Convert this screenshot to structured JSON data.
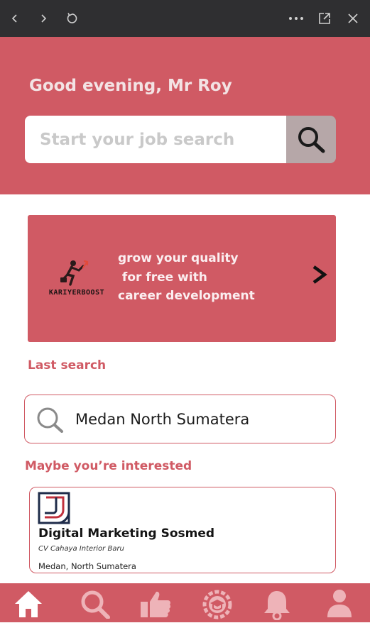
{
  "browser": {
    "back_icon": "chevron-left-icon",
    "forward_icon": "chevron-right-icon",
    "reload_icon": "reload-icon",
    "more_icon": "more-dots-icon",
    "popout_icon": "open-external-icon",
    "close_icon": "close-icon"
  },
  "header": {
    "greeting": "Good evening, Mr Roy",
    "search_placeholder": "Start your job search",
    "search_button_icon": "search-icon"
  },
  "banner": {
    "logo_text": "KARIYERBOOST",
    "line1": "grow your quality",
    "line2": " for free with",
    "line3": "career development",
    "arrow_icon": "chevron-right-icon"
  },
  "last_search": {
    "title": "Last search",
    "query": "Medan North Sumatera"
  },
  "recommended": {
    "title": "Maybe you’re interested",
    "job": {
      "title": "Digital Marketing Sosmed",
      "company": "CV Cahaya Interior Baru",
      "location": "Medan, North Sumatera"
    }
  },
  "nav": [
    {
      "name": "home",
      "icon": "home-icon",
      "active": true
    },
    {
      "name": "search",
      "icon": "search-icon",
      "active": false
    },
    {
      "name": "recommendations",
      "icon": "thumbs-up-icon",
      "active": false
    },
    {
      "name": "courses",
      "icon": "graduation-badge-icon",
      "active": false
    },
    {
      "name": "notifications",
      "icon": "bell-icon",
      "active": false
    },
    {
      "name": "profile",
      "icon": "person-icon",
      "active": false
    }
  ],
  "colors": {
    "brand": "#d05a64",
    "topbar": "#2f2f31",
    "search_button": "#b6a7a8",
    "nav_inactive_icon": "#eeb3b8",
    "nav_active_icon": "#ffffff",
    "logo_navy": "#1f2c4a",
    "logo_red": "#c0303c"
  }
}
